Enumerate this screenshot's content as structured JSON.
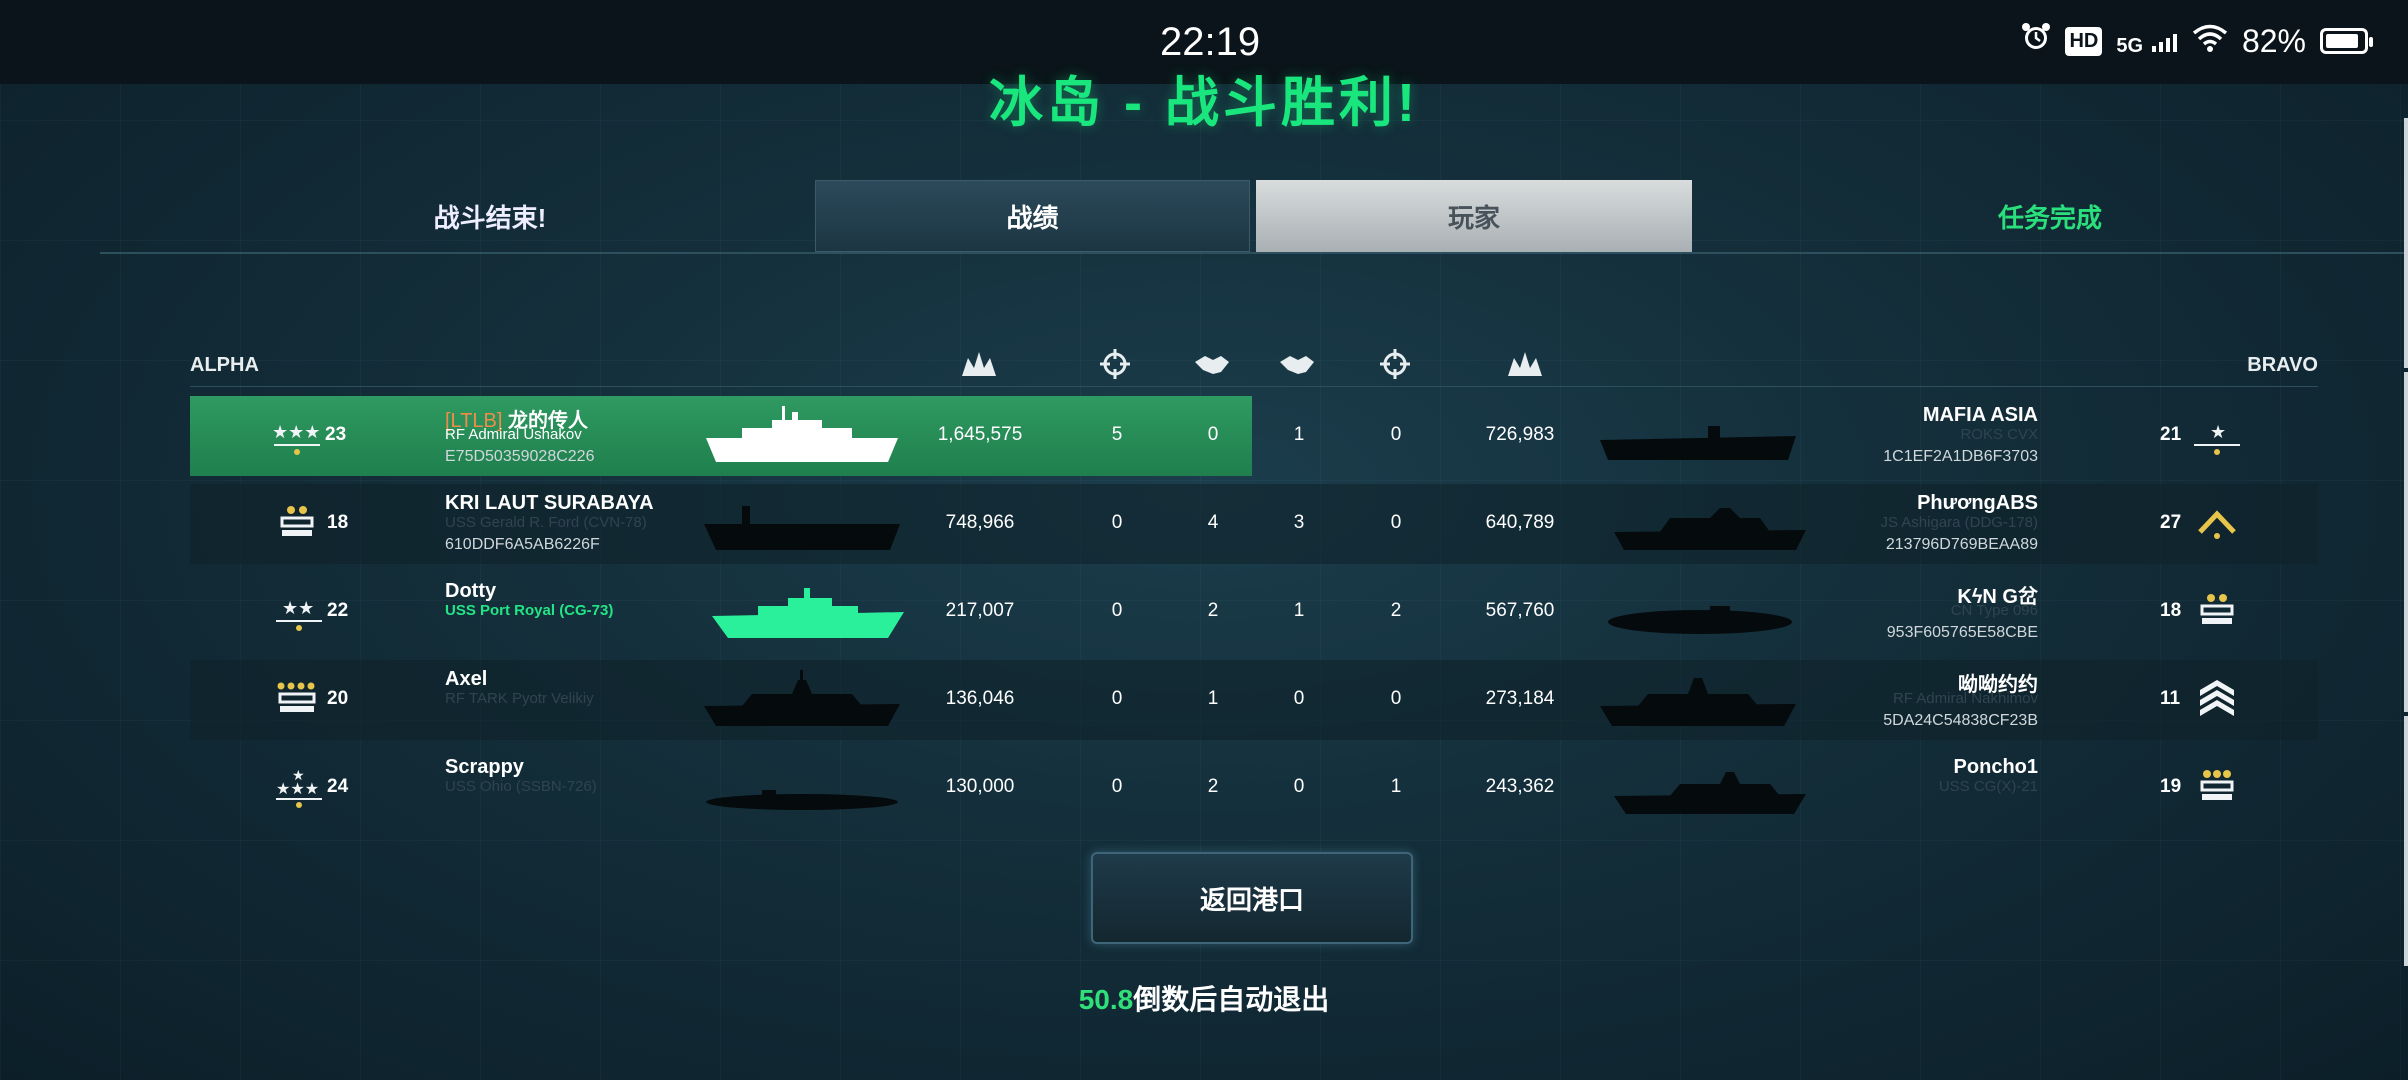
{
  "status_bar": {
    "time": "22:19",
    "network": "5G",
    "hd_label": "HD",
    "battery": "82%"
  },
  "title": "冰岛 - 战斗胜利!",
  "tabs": {
    "battle_end": "战斗结束!",
    "stats": "战绩",
    "players": "玩家",
    "mission": "任务完成"
  },
  "table": {
    "team_left": "ALPHA",
    "team_right": "BRAVO",
    "column_icons": [
      "damage-icon",
      "kills-icon",
      "assists-icon",
      "assists-icon",
      "kills-icon",
      "damage-icon"
    ],
    "rows": [
      {
        "alpha": {
          "clan": "[LTLB]",
          "name": "龙的传人",
          "ship": "RF Admiral Ushakov",
          "id": "E75D50359028C226",
          "level": "23",
          "rank": "three-stars"
        },
        "alpha_damage": "1,645,575",
        "alpha_kills": "5",
        "alpha_assists": "0",
        "bravo_assists": "1",
        "bravo_kills": "0",
        "bravo_damage": "726,983",
        "bravo": {
          "name": "MAFIA ASIA",
          "ship": "ROKS CVX",
          "id": "1C1EF2A1DB6F3703",
          "level": "21",
          "rank": "one-star"
        }
      },
      {
        "alpha": {
          "clan": "",
          "name": "KRI LAUT SURABAYA",
          "ship": "USS Gerald R. Ford (CVN-78)",
          "id": "610DDF6A5AB6226F",
          "level": "18",
          "rank": "two-bars"
        },
        "alpha_damage": "748,966",
        "alpha_kills": "0",
        "alpha_assists": "4",
        "bravo_assists": "3",
        "bravo_kills": "0",
        "bravo_damage": "640,789",
        "bravo": {
          "name": "PhươngABS",
          "ship": "JS Ashigara (DDG-178)",
          "id": "213796D769BEAA89",
          "level": "27",
          "rank": "chevron"
        }
      },
      {
        "alpha": {
          "clan": "",
          "name": "Dotty",
          "ship": "USS Port Royal (CG-73)",
          "id": "",
          "level": "22",
          "rank": "two-stars"
        },
        "alpha_damage": "217,007",
        "alpha_kills": "0",
        "alpha_assists": "2",
        "bravo_assists": "1",
        "bravo_kills": "2",
        "bravo_damage": "567,760",
        "bravo": {
          "name": "KϟN G岔",
          "ship": "CN Type 096",
          "id": "953F605765E58CBE",
          "level": "18",
          "rank": "two-bars"
        }
      },
      {
        "alpha": {
          "clan": "",
          "name": "Axel",
          "ship": "RF TARK Pyotr Velikiy",
          "id": "",
          "level": "20",
          "rank": "four-bars"
        },
        "alpha_damage": "136,046",
        "alpha_kills": "0",
        "alpha_assists": "1",
        "bravo_assists": "0",
        "bravo_kills": "0",
        "bravo_damage": "273,184",
        "bravo": {
          "name": "呦呦约约",
          "ship": "RF Admiral Nakhimov",
          "id": "5DA24C54838CF23B",
          "level": "11",
          "rank": "sergeant"
        }
      },
      {
        "alpha": {
          "clan": "",
          "name": "Scrappy",
          "ship": "USS Ohio (SSBN-726)",
          "id": "",
          "level": "24",
          "rank": "four-stars"
        },
        "alpha_damage": "130,000",
        "alpha_kills": "0",
        "alpha_assists": "2",
        "bravo_assists": "0",
        "bravo_kills": "1",
        "bravo_damage": "243,362",
        "bravo": {
          "name": "Poncho1",
          "ship": "USS CG(X)-21",
          "id": "",
          "level": "19",
          "rank": "three-bars"
        }
      }
    ]
  },
  "return_button": "返回港口",
  "countdown": {
    "seconds": "50.8",
    "text": "倒数后自动退出"
  },
  "colors": {
    "accent_green": "#19e67d",
    "highlight_row": "#2a9160",
    "clan_orange": "#f28b48"
  }
}
